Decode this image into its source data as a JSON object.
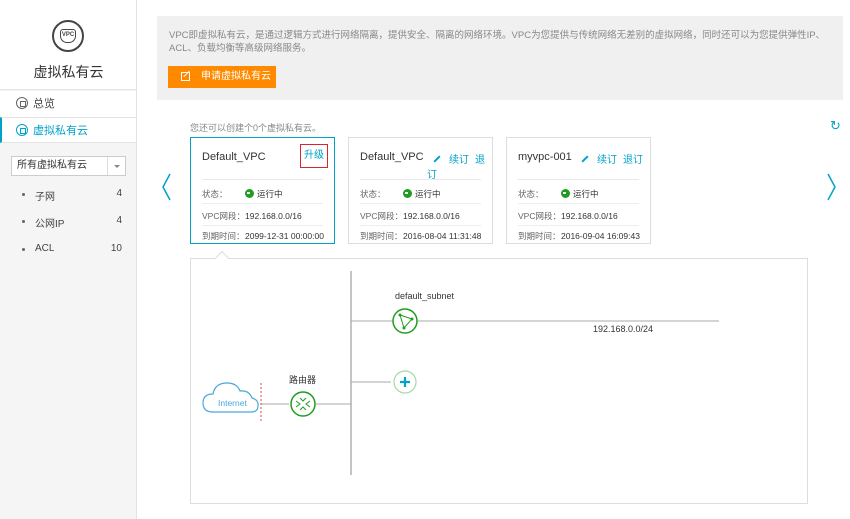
{
  "sidebar": {
    "logo_text": "VPC",
    "title": "虚拟私有云",
    "nav": [
      {
        "label": "总览"
      },
      {
        "label": "虚拟私有云"
      }
    ],
    "select_value": "所有虚拟私有云",
    "items": [
      {
        "label": "子网",
        "count": "4"
      },
      {
        "label": "公网IP",
        "count": "4"
      },
      {
        "label": "ACL",
        "count": "10"
      }
    ]
  },
  "info": {
    "description": "VPC即虚拟私有云，是通过逻辑方式进行网络隔离，提供安全、隔离的网络环境。VPC为您提供与传统网络无差别的虚拟网络，同时还可以为您提供弹性IP、ACL、负载均衡等高级网络服务。",
    "apply_button": "申请虚拟私有云"
  },
  "quota_text": "您还可以创建个0个虚拟私有云。",
  "cards": [
    {
      "name": "Default_VPC",
      "upgrade": "升级",
      "status_label": "状态：",
      "status": "运行中",
      "segment_label": "VPC网段：",
      "segment": "192.168.0.0/16",
      "expire_label": "到期时间：",
      "expire": "2099-12-31 00:00:00"
    },
    {
      "name": "Default_VPC",
      "renew": "续订",
      "unsubscribe": "退订",
      "status_label": "状态：",
      "status": "运行中",
      "segment_label": "VPC网段：",
      "segment": "192.168.0.0/16",
      "expire_label": "到期时间：",
      "expire": "2016-08-04 11:31:48"
    },
    {
      "name": "myvpc-001",
      "renew": "续订",
      "unsubscribe": "退订",
      "status_label": "状态：",
      "status": "运行中",
      "segment_label": "VPC网段：",
      "segment": "192.168.0.0/16",
      "expire_label": "到期时间：",
      "expire": "2016-09-04 16:09:43"
    }
  ],
  "topology": {
    "internet_label": "Internet",
    "router_label": "路由器",
    "subnet_name": "default_subnet",
    "subnet_cidr": "192.168.0.0/24"
  },
  "colors": {
    "accent": "#00a2ca",
    "orange": "#ff8a00",
    "green": "#1e9e1e"
  }
}
